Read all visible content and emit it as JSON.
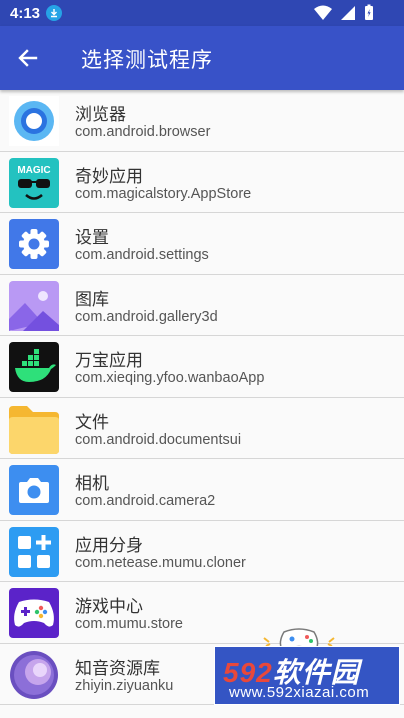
{
  "status_bar": {
    "time": "4:13"
  },
  "app_bar": {
    "title": "选择测试程序"
  },
  "apps": [
    {
      "name": "浏览器",
      "package": "com.android.browser",
      "icon": "browser-icon"
    },
    {
      "name": "奇妙应用",
      "package": "com.magicalstory.AppStore",
      "icon": "magic-app-icon",
      "icon_text": "MAGIC"
    },
    {
      "name": "设置",
      "package": "com.android.settings",
      "icon": "settings-gear-icon"
    },
    {
      "name": "图库",
      "package": "com.android.gallery3d",
      "icon": "gallery-icon"
    },
    {
      "name": "万宝应用",
      "package": "com.xieqing.yfoo.wanbaoApp",
      "icon": "docker-whale-icon"
    },
    {
      "name": "文件",
      "package": "com.android.documentsui",
      "icon": "folder-icon"
    },
    {
      "name": "相机",
      "package": "com.android.camera2",
      "icon": "camera-icon"
    },
    {
      "name": "应用分身",
      "package": "com.netease.mumu.cloner",
      "icon": "app-cloner-icon"
    },
    {
      "name": "游戏中心",
      "package": "com.mumu.store",
      "icon": "gamepad-icon"
    },
    {
      "name": "知音资源库",
      "package": "zhiyin.ziyuanku",
      "icon": "planet-icon"
    }
  ],
  "watermark": {
    "brand_num": "592",
    "brand_text": "软件园",
    "url": "www.592xiazai.com"
  },
  "colors": {
    "status_bar": "#2f47b3",
    "app_bar": "#3852c8",
    "watermark_bg": "#3455c4"
  }
}
